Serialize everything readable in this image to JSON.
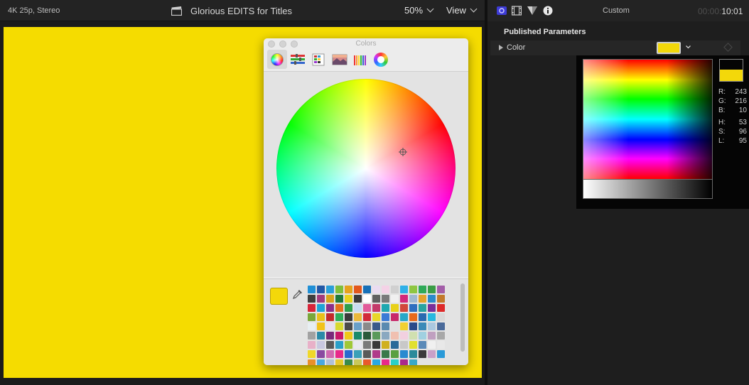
{
  "viewer": {
    "format": "4K 25p, Stereo",
    "project_title": "Glorious EDITS for Titles",
    "zoom": "50%",
    "view_menu": "View",
    "canvas_color": "#f5dc00"
  },
  "colors_panel": {
    "title": "Colors",
    "tabs": [
      {
        "icon": "color-wheel-icon"
      },
      {
        "icon": "color-sliders-icon"
      },
      {
        "icon": "color-palettes-icon"
      },
      {
        "icon": "image-palettes-icon"
      },
      {
        "icon": "pencils-icon"
      },
      {
        "icon": "plugin-s-icon"
      }
    ],
    "current_color": "#f3d80a",
    "palette": [
      "#1f8fd6",
      "#2258a6",
      "#2a9fd8",
      "#7fbf3a",
      "#e6a21c",
      "#e3581c",
      "#1770b8",
      "#eadcf0",
      "#f4d2e6",
      "#d0d0d0",
      "#2fb0e8",
      "#8ec641",
      "#2faa58",
      "#3a9d46",
      "#a35ea8",
      "#3e3e3e",
      "#a33a7c",
      "#d8a31c",
      "#1f7a3c",
      "#e8d11a",
      "#3a3a3a",
      "#ffffff",
      "#606060",
      "#7a7a7a",
      "#f0f0f0",
      "#d22a7a",
      "#9fb8d0",
      "#e3a32c",
      "#2b8acb",
      "#c27a2c",
      "#d8253a",
      "#1fa3d6",
      "#8e2f8a",
      "#e5721c",
      "#2f9f4a",
      "#c9dcf0",
      "#e25a9a",
      "#c33a6a",
      "#1fa8b0",
      "#e8d11a",
      "#d2473a",
      "#2f6ec0",
      "#28a3a0",
      "#7a2f9a",
      "#de2a2a",
      "#7aa83a",
      "#e8c01a",
      "#c42a2a",
      "#2fae5a",
      "#3a3a3a",
      "#eab83a",
      "#d22a3a",
      "#e8d82a",
      "#3a7ad6",
      "#c82a6a",
      "#28a8c8",
      "#e86a1c",
      "#2a6ab0",
      "#28b8e0",
      "#d8d8d8",
      "#e7eef2",
      "#f2c21a",
      "#eae0f0",
      "#d8d830",
      "#4a4a4a",
      "#6aa0c8",
      "#8a8a8a",
      "#3a5a8a",
      "#5a8ab0",
      "#e0e0e0",
      "#f2d030",
      "#2a4a8a",
      "#3a8ab8",
      "#aac8e0",
      "#4a6a9a",
      "#a2a2a2",
      "#2a8aa8",
      "#7a2a7a",
      "#c8186a",
      "#f0c81a",
      "#1a8a6a",
      "#2a5a3a",
      "#5a9a5a",
      "#8aa8c0",
      "#f0c0b0",
      "#f2d0e0",
      "#d0e0b0",
      "#a0d0e0",
      "#c0a0c0",
      "#a8a8a8",
      "#e8b0c8",
      "#c8c8e0",
      "#5a5a5a",
      "#2aa0c8",
      "#a0c838",
      "#e8e8f0",
      "#7a7a7a",
      "#3a3a3a",
      "#d0b020",
      "#2a6a9a",
      "#c8c8c8",
      "#e0e030",
      "#5a8ab8",
      "#f0f0f0",
      "#e8e8e8",
      "#f0d82a",
      "#8a4aa0",
      "#d06ab0",
      "#e82a8a",
      "#2a6ad0",
      "#3aa0b8",
      "#5a5a5a",
      "#b03a8a",
      "#3a7a4a",
      "#5aa040",
      "#2a8ad0",
      "#2a8a9a",
      "#3a3a3a",
      "#c8a0c8",
      "#2a9ad8",
      "#e8902a",
      "#4aa8e0",
      "#b0c0d8",
      "#e8c82a",
      "#3a8a4a",
      "#c8c858",
      "#e85a2a",
      "#2aa8e0",
      "#e82a8a",
      "#2ad0c8",
      "#aa2a8a",
      "#3aa8c8"
    ]
  },
  "inspector": {
    "tabs": [
      {
        "icon": "generator-icon"
      },
      {
        "icon": "video-filmstrip-icon"
      },
      {
        "icon": "transition-icon"
      },
      {
        "icon": "info-icon"
      }
    ],
    "title": "Custom",
    "timecode_dim": "00:00:",
    "timecode": "10:01",
    "published_parameters": "Published Parameters",
    "color_param": {
      "label": "Color",
      "swatch": "#f3d80a"
    },
    "picker": {
      "old_color": "#050505",
      "new_color": "#f3d80a",
      "values": [
        {
          "label": "R:",
          "value": "243"
        },
        {
          "label": "G:",
          "value": "216"
        },
        {
          "label": "B:",
          "value": "10"
        },
        {
          "label": "H:",
          "value": "53"
        },
        {
          "label": "S:",
          "value": "96"
        },
        {
          "label": "L:",
          "value": "95"
        }
      ]
    }
  }
}
